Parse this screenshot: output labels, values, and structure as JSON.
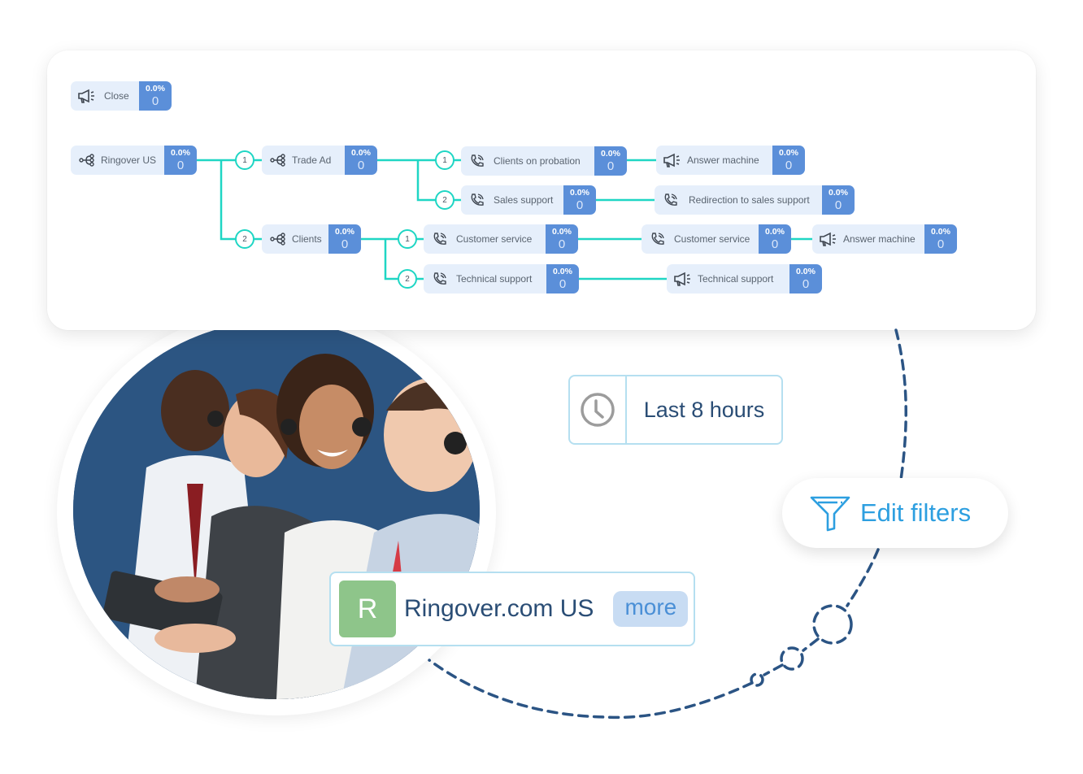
{
  "flow": {
    "connector_color": "#1fd6c4",
    "node_label_bg": "#e6effb",
    "node_stat_bg": "#5b8fd9",
    "nodes": [
      {
        "id": "close",
        "icon": "megaphone-icon",
        "label": "Close",
        "pct": "0.0%",
        "count": "0"
      },
      {
        "id": "ringover-us",
        "icon": "branch-icon",
        "label": "Ringover US",
        "pct": "0.0%",
        "count": "0"
      },
      {
        "id": "trade-ad",
        "icon": "branch-icon",
        "label": "Trade Ad",
        "pct": "0.0%",
        "count": "0"
      },
      {
        "id": "clients-on-probation",
        "icon": "phone-icon",
        "label": "Clients on probation",
        "pct": "0.0%",
        "count": "0"
      },
      {
        "id": "answer-machine-1",
        "icon": "megaphone-icon",
        "label": "Answer machine",
        "pct": "0.0%",
        "count": "0"
      },
      {
        "id": "sales-support",
        "icon": "phone-icon",
        "label": "Sales support",
        "pct": "0.0%",
        "count": "0"
      },
      {
        "id": "redirection-sales-support",
        "icon": "phone-icon",
        "label": "Redirection to sales support",
        "pct": "0.0%",
        "count": "0"
      },
      {
        "id": "clients",
        "icon": "branch-icon",
        "label": "Clients",
        "pct": "0.0%",
        "count": "0"
      },
      {
        "id": "customer-service-1",
        "icon": "phone-icon",
        "label": "Customer service",
        "pct": "0.0%",
        "count": "0"
      },
      {
        "id": "customer-service-2",
        "icon": "phone-icon",
        "label": "Customer service",
        "pct": "0.0%",
        "count": "0"
      },
      {
        "id": "answer-machine-2",
        "icon": "megaphone-icon",
        "label": "Answer machine",
        "pct": "0.0%",
        "count": "0"
      },
      {
        "id": "technical-support-1",
        "icon": "phone-icon",
        "label": "Technical support",
        "pct": "0.0%",
        "count": "0"
      },
      {
        "id": "technical-support-2",
        "icon": "megaphone-icon",
        "label": "Technical support",
        "pct": "0.0%",
        "count": "0"
      }
    ],
    "badges": [
      "1",
      "2",
      "1",
      "2",
      "1",
      "2"
    ]
  },
  "time_filter": {
    "icon": "clock-icon",
    "label": "Last 8 hours"
  },
  "edit_filters": {
    "icon": "funnel-icon",
    "label": "Edit filters"
  },
  "account": {
    "avatar_letter": "R",
    "avatar_color": "#8ec58a",
    "name": "Ringover.com US",
    "more_label": "more"
  },
  "photo": {
    "description": "call center agents wearing headsets"
  }
}
